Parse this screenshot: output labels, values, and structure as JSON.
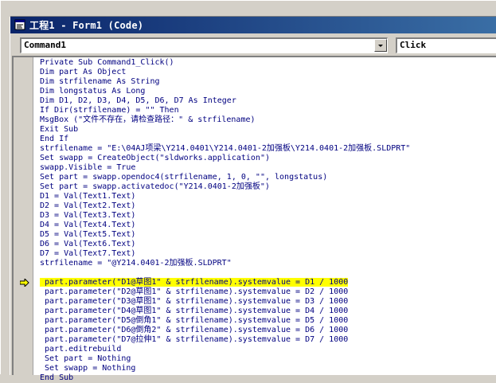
{
  "window": {
    "title": "工程1 - Form1 (Code)"
  },
  "combos": {
    "object_value": "Command1",
    "procedure_value": "Click"
  },
  "code": {
    "current_line_index": 23,
    "lines": [
      "Private Sub Command1_Click()",
      "Dim part As Object",
      "Dim strfilename As String",
      "Dim longstatus As Long",
      "Dim D1, D2, D3, D4, D5, D6, D7 As Integer",
      "If Dir(strfilename) = \"\" Then",
      "MsgBox (\"文件不存在，请检查路径：\" & strfilename)",
      "Exit Sub",
      "End If",
      "strfilename = \"E:\\04AJ项梁\\Y214.0401\\Y214.0401-2加强板\\Y214.0401-2加强板.SLDPRT\"",
      "Set swapp = CreateObject(\"sldworks.application\")",
      "swapp.Visible = True",
      "Set part = swapp.opendoc4(strfilename, 1, 0, \"\", longstatus)",
      "Set part = swapp.activatedoc(\"Y214.0401-2加强板\")",
      "D1 = Val(Text1.Text)",
      "D2 = Val(Text2.Text)",
      "D3 = Val(Text3.Text)",
      "D4 = Val(Text4.Text)",
      "D5 = Val(Text5.Text)",
      "D6 = Val(Text6.Text)",
      "D7 = Val(Text7.Text)",
      "strfilename = \"@Y214.0401-2加强板.SLDPRT\"",
      "",
      " part.parameter(\"D1@草图1\" & strfilename).systemvalue = D1 / 1000",
      " part.parameter(\"D2@草图1\" & strfilename).systemvalue = D2 / 1000",
      " part.parameter(\"D3@草图1\" & strfilename).systemvalue = D3 / 1000",
      " part.parameter(\"D4@草图1\" & strfilename).systemvalue = D4 / 1000",
      " part.parameter(\"D5@倒角1\" & strfilename).systemvalue = D5 / 1000",
      " part.parameter(\"D6@倒角2\" & strfilename).systemvalue = D6 / 1000",
      " part.parameter(\"D7@拉伸1\" & strfilename).systemvalue = D7 / 1000",
      " part.editrebuild",
      " Set part = Nothing",
      " Set swapp = Nothing",
      "End Sub"
    ]
  },
  "colors": {
    "code_text": "#000080",
    "current_line_highlight": "#ffff00",
    "arrow_fill": "#ffff00"
  }
}
